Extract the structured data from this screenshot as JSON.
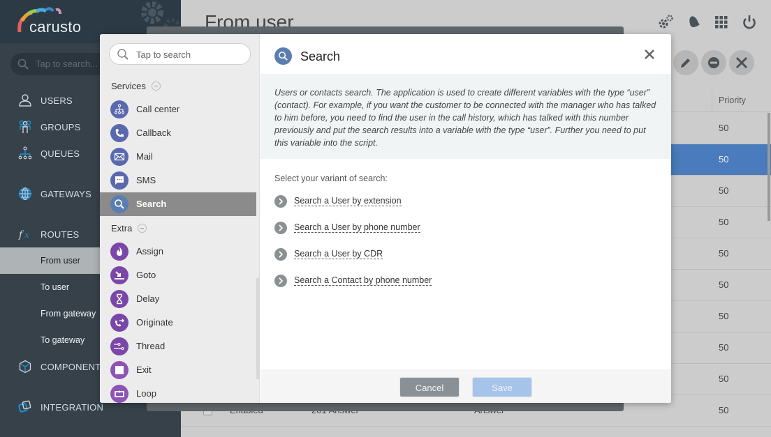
{
  "app": {
    "logo_text": "carusto",
    "sidebar_search_placeholder": "Tap to search..."
  },
  "sidebar": {
    "items": [
      {
        "label": "USERS",
        "icon": "user-icon"
      },
      {
        "label": "GROUPS",
        "icon": "groups-icon"
      },
      {
        "label": "QUEUES",
        "icon": "queues-icon"
      },
      {
        "label": "GATEWAYS",
        "icon": "globe-icon"
      },
      {
        "label": "ROUTES",
        "icon": "fx-icon"
      },
      {
        "label": "COMPONENTS",
        "icon": "cube-icon"
      },
      {
        "label": "INTEGRATION",
        "icon": "integration-icon"
      }
    ],
    "route_subitems": [
      {
        "label": "From user",
        "active": true
      },
      {
        "label": "To user",
        "active": false
      },
      {
        "label": "From gateway",
        "active": false
      },
      {
        "label": "To gateway",
        "active": false
      }
    ]
  },
  "header": {
    "title": "From user",
    "icons": [
      "settings-icon",
      "bell-icon",
      "apps-grid-icon",
      "power-icon"
    ],
    "actions": [
      "edit-icon",
      "disable-icon",
      "delete-icon"
    ]
  },
  "table": {
    "columns": [
      "Priority"
    ],
    "rows": [
      {
        "priority": "50",
        "selected": false
      },
      {
        "priority": "50",
        "selected": true
      },
      {
        "priority": "50",
        "selected": false
      },
      {
        "priority": "50",
        "selected": false
      },
      {
        "priority": "50",
        "selected": false
      },
      {
        "priority": "50",
        "selected": false
      },
      {
        "priority": "50",
        "selected": false
      },
      {
        "priority": "50",
        "selected": false
      },
      {
        "priority": "50",
        "selected": false
      },
      {
        "priority": "50",
        "selected": false,
        "status": "Enabled",
        "name": "201 Answer",
        "type": "Answer"
      }
    ]
  },
  "modal": {
    "search_placeholder": "Tap to search",
    "groups": [
      {
        "label": "Services",
        "items": [
          {
            "label": "Call center",
            "icon": "call-center-icon"
          },
          {
            "label": "Callback",
            "icon": "phone-icon"
          },
          {
            "label": "Mail",
            "icon": "mail-icon"
          },
          {
            "label": "SMS",
            "icon": "sms-icon"
          },
          {
            "label": "Search",
            "icon": "search-icon",
            "active": true
          }
        ]
      },
      {
        "label": "Extra",
        "items": [
          {
            "label": "Assign",
            "icon": "flame-icon"
          },
          {
            "label": "Goto",
            "icon": "goto-icon"
          },
          {
            "label": "Delay",
            "icon": "hourglass-icon"
          },
          {
            "label": "Originate",
            "icon": "originate-icon"
          },
          {
            "label": "Thread",
            "icon": "thread-icon"
          },
          {
            "label": "Exit",
            "icon": "stop-icon"
          },
          {
            "label": "Loop",
            "icon": "loop-icon"
          }
        ]
      }
    ],
    "title": "Search",
    "description": "Users or contacts search. The application is used to create different variables with the type “user” (contact). For example, if you want the customer to be connected with the manager who has talked to him before, you need to find the user in the call history, which has talked with this number previously and put the search results into a variable with the type “user”. Further you need to put this variable into the script.",
    "prompt": "Select your variant of search:",
    "options": [
      "Search a User by extension",
      "Search a User by phone number",
      "Search a User by CDR",
      "Search a Contact by phone number"
    ],
    "cancel_label": "Cancel",
    "save_label": "Save"
  }
}
